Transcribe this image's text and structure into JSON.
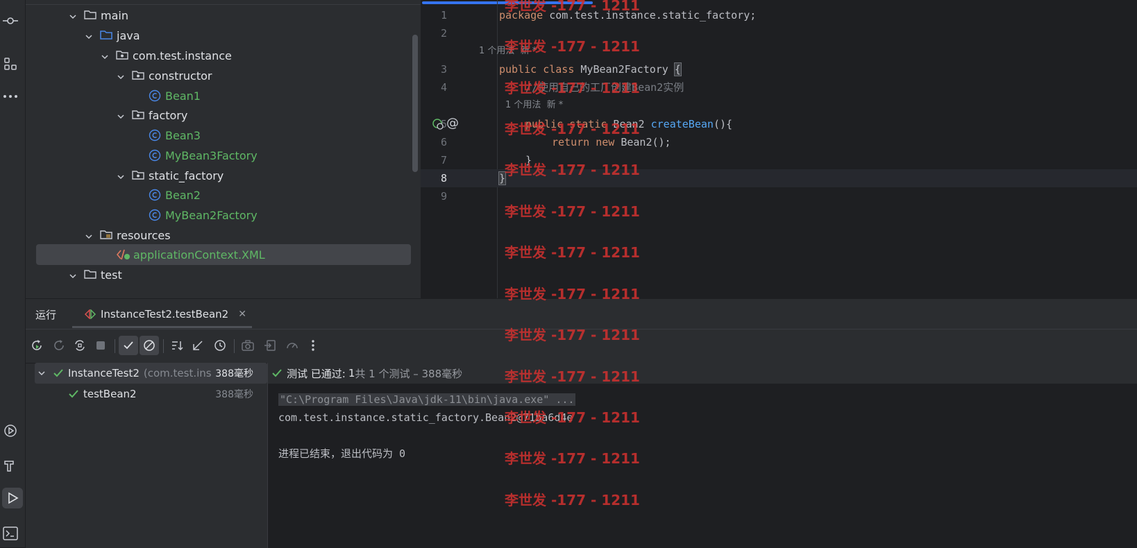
{
  "project_tree": {
    "items": [
      {
        "label": "main",
        "icon": "folder-icon",
        "color": "white"
      },
      {
        "label": "java",
        "icon": "source-folder-icon",
        "color": "white"
      },
      {
        "label": "com.test.instance",
        "icon": "package-icon",
        "color": "white"
      },
      {
        "label": "constructor",
        "icon": "package-icon",
        "color": "white"
      },
      {
        "label": "Bean1",
        "icon": "class-icon",
        "color": "green"
      },
      {
        "label": "factory",
        "icon": "package-icon",
        "color": "white"
      },
      {
        "label": "Bean3",
        "icon": "class-icon",
        "color": "green"
      },
      {
        "label": "MyBean3Factory",
        "icon": "class-icon",
        "color": "green"
      },
      {
        "label": "static_factory",
        "icon": "package-icon",
        "color": "white"
      },
      {
        "label": "Bean2",
        "icon": "class-icon",
        "color": "green"
      },
      {
        "label": "MyBean2Factory",
        "icon": "class-icon",
        "color": "green"
      },
      {
        "label": "resources",
        "icon": "resources-folder-icon",
        "color": "white"
      },
      {
        "label": "applicationContext.XML",
        "icon": "xml-file-icon",
        "color": "green"
      },
      {
        "label": "test",
        "icon": "folder-icon",
        "color": "white"
      }
    ]
  },
  "editor": {
    "line_numbers": [
      "1",
      "2",
      "3",
      "4",
      "5",
      "6",
      "7",
      "8",
      "9"
    ],
    "current_line": "8",
    "code": {
      "l1_kw": "package",
      "l1_rest": " com.test.instance.static_factory;",
      "l3_kw": "public class",
      "l3_rest": " MyBean2Factory ",
      "l3_brace": "{",
      "l4_comment": "//使用自己的工厂创建Bean2实例",
      "l5_kw": "public static",
      "l5_type": " Bean2 ",
      "l5_fn": "createBean",
      "l5_rest": "(){",
      "l6_kw1": "return",
      "l6_kw2": " new",
      "l6_rest": " Bean2();",
      "l7": "}",
      "l8": "}"
    },
    "hints": {
      "class_usages": "1 个用法",
      "class_new": "新 *",
      "method_usages": "1 个用法",
      "method_new": "新 *"
    }
  },
  "run_window": {
    "title": "运行",
    "tab_label": "InstanceTest2.testBean2",
    "test_tree": {
      "root_label": "InstanceTest2",
      "root_package": "(com.test.inst",
      "root_duration": "388毫秒",
      "child_label": "testBean2",
      "child_duration": "388毫秒"
    },
    "status": {
      "prefix": "测试 已通过:",
      "count": "1",
      "suffix": "共 1 个测试 – 388毫秒"
    },
    "console": {
      "command": "\"C:\\Program Files\\Java\\jdk-11\\bin\\java.exe\" ...",
      "output": "com.test.instance.static_factory.Bean2@71ba6d4e",
      "exit": "进程已结束，退出代码为 0"
    }
  },
  "watermark": {
    "text": "李世发 -177 - 1211"
  },
  "colors": {
    "accent": "#3574f0",
    "pass_green": "#5fb865",
    "keyword": "#cf8e6d",
    "function": "#56a8f5",
    "watermark_red": "#d23230"
  }
}
